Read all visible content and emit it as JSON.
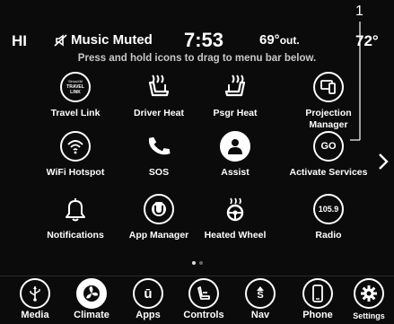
{
  "status": {
    "hvac_left": "HI",
    "music": "Music Muted",
    "time": "7:53",
    "outside_temp": "69°",
    "outside_unit": "out.",
    "hvac_right": "72°"
  },
  "callout_number": "1",
  "hint": "Press and hold icons to drag to menu bar below.",
  "apps": [
    {
      "label": "Travel Link",
      "icon": "sirius-travel-link-icon",
      "icon_text": [
        "SiriusXM",
        "TRAVEL",
        "LINK"
      ]
    },
    {
      "label": "Driver Heat",
      "icon": "driver-seat-heat-icon"
    },
    {
      "label": "Psgr Heat",
      "icon": "passenger-seat-heat-icon"
    },
    {
      "label": "Projection Manager",
      "icon": "projection-manager-icon"
    },
    {
      "label": "WiFi Hotspot",
      "icon": "wifi-icon"
    },
    {
      "label": "SOS",
      "icon": "phone-handset-icon"
    },
    {
      "label": "Assist",
      "icon": "assist-person-icon"
    },
    {
      "label": "Activate Services",
      "icon": "go-icon",
      "icon_text": "GO"
    },
    {
      "label": "Notifications",
      "icon": "bell-icon"
    },
    {
      "label": "App Manager",
      "icon": "app-manager-icon"
    },
    {
      "label": "Heated Wheel",
      "icon": "heated-wheel-icon"
    },
    {
      "label": "Radio",
      "icon": "radio-icon",
      "icon_text": "105.9"
    }
  ],
  "page_indicator": {
    "pages": 2,
    "current": 1
  },
  "menu": [
    {
      "label": "Media",
      "icon": "usb-media-icon"
    },
    {
      "label": "Climate",
      "icon": "climate-fan-icon"
    },
    {
      "label": "Apps",
      "icon": "apps-icon",
      "icon_text": "ū"
    },
    {
      "label": "Controls",
      "icon": "controls-seat-icon"
    },
    {
      "label": "Nav",
      "icon": "nav-icon",
      "icon_text": "S"
    },
    {
      "label": "Phone",
      "icon": "phone-icon"
    },
    {
      "label": "Settings",
      "icon": "gear-icon"
    }
  ]
}
